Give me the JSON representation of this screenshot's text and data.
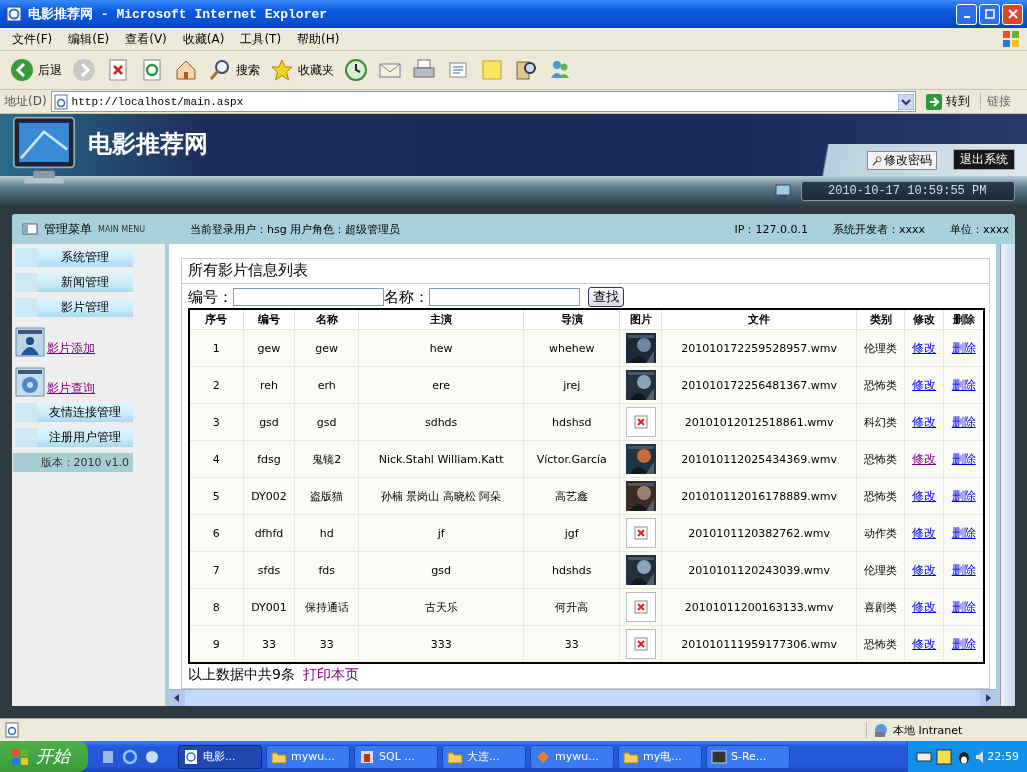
{
  "window": {
    "title": "电影推荐网 - Microsoft Internet Explorer"
  },
  "menu_bar": [
    "文件(F)",
    "编辑(E)",
    "查看(V)",
    "收藏(A)",
    "工具(T)",
    "帮助(H)"
  ],
  "toolbar": [
    {
      "kind": "back",
      "label": "后退"
    },
    {
      "kind": "forward"
    },
    {
      "kind": "stop"
    },
    {
      "kind": "refresh"
    },
    {
      "kind": "home"
    },
    {
      "kind": "search",
      "label": "搜索"
    },
    {
      "kind": "favorites",
      "label": "收藏夹"
    },
    {
      "kind": "history"
    },
    {
      "kind": "mail"
    },
    {
      "kind": "print"
    },
    {
      "kind": "edit"
    },
    {
      "kind": "notes"
    },
    {
      "kind": "research"
    },
    {
      "kind": "messenger"
    }
  ],
  "address_bar": {
    "label": "地址(D)",
    "value": "http://localhost/main.aspx",
    "go": "转到",
    "links": "链接"
  },
  "site": {
    "title": "电影推荐网",
    "change_password": "修改密码",
    "logout": "退出系统",
    "datetime": "2010-10-17 10:59:55 PM"
  },
  "info_bar": {
    "menu_title": "管理菜单",
    "menu_subtitle": "MAIN MENU",
    "user": "当前登录用户：hsg  用户角色：超级管理员",
    "ip": "IP：127.0.0.1",
    "developer": "系统开发者：xxxx",
    "unit": "单位：xxxx"
  },
  "sidebar": {
    "items": [
      {
        "kind": "section",
        "label": "系统管理"
      },
      {
        "kind": "section",
        "label": "新闻管理"
      },
      {
        "kind": "section",
        "label": "影片管理"
      },
      {
        "kind": "link",
        "label": "影片添加"
      },
      {
        "kind": "link",
        "label": "影片查询"
      },
      {
        "kind": "section",
        "label": "友情连接管理"
      },
      {
        "kind": "section",
        "label": "注册用户管理"
      }
    ],
    "version": "版本：2010 v1.0"
  },
  "panel": {
    "title": "所有影片信息列表",
    "search_fields": [
      {
        "label": "编号："
      },
      {
        "label": "名称："
      }
    ],
    "search_button": "查找",
    "footer": "以上数据中共9条",
    "print_link": "打印本页"
  },
  "table": {
    "columns": [
      "序号",
      "编号",
      "名称",
      "主演",
      "导演",
      "图片",
      "文件",
      "类别",
      "修改",
      "删除"
    ],
    "rows": [
      {
        "no": "1",
        "code": "gew",
        "name": "gew",
        "actors": "hew",
        "director": "whehew",
        "file": "201010172259528957.wmv",
        "genre": "伦理类",
        "edit": "修改",
        "edit_visited": false,
        "delete": "删除"
      },
      {
        "no": "2",
        "code": "reh",
        "name": "erh",
        "actors": "ere",
        "director": "jrej",
        "file": "201010172256481367.wmv",
        "genre": "恐怖类",
        "edit": "修改",
        "edit_visited": false,
        "delete": "删除"
      },
      {
        "no": "3",
        "code": "gsd",
        "name": "gsd",
        "actors": "sdhds",
        "director": "hdshsd",
        "poster": {
          "kind": "broken"
        },
        "file": "20101012012518861.wmv",
        "genre": "科幻类",
        "edit": "修改",
        "edit_visited": false,
        "delete": "删除"
      },
      {
        "no": "4",
        "code": "fdsg",
        "name": "鬼镜2",
        "actors": "Nick.Stahl William.Katt",
        "director": "Víctor.García",
        "file": "201010112025434369.wmv",
        "genre": "恐怖类",
        "edit": "修改",
        "edit_visited": true,
        "delete": "删除"
      },
      {
        "no": "5",
        "code": "DY002",
        "name": "盗版猫",
        "actors": "孙楠 景岗山 高晓松 阿朵",
        "director": "高艺鑫",
        "file": "201010112016178889.wmv",
        "genre": "恐怖类",
        "edit": "修改",
        "edit_visited": false,
        "delete": "删除"
      },
      {
        "no": "6",
        "code": "dfhfd",
        "name": "hd",
        "actors": "jf",
        "director": "jgf",
        "poster": {
          "kind": "broken"
        },
        "file": "2010101120382762.wmv",
        "genre": "动作类",
        "edit": "修改",
        "edit_visited": false,
        "delete": "删除"
      },
      {
        "no": "7",
        "code": "sfds",
        "name": "fds",
        "actors": "gsd",
        "director": "hdshds",
        "file": "2010101120243039.wmv",
        "genre": "伦理类",
        "edit": "修改",
        "edit_visited": false,
        "delete": "删除"
      },
      {
        "no": "8",
        "code": "DY001",
        "name": "保持通话",
        "actors": "古天乐",
        "director": "何升高",
        "poster": {
          "kind": "broken"
        },
        "file": "20101011200163133.wmv",
        "genre": "喜剧类",
        "edit": "修改",
        "edit_visited": false,
        "delete": "删除"
      },
      {
        "no": "9",
        "code": "33",
        "name": "33",
        "actors": "333",
        "director": "33",
        "poster": {
          "kind": "broken"
        },
        "file": "201010111959177306.wmv",
        "genre": "恐怖类",
        "edit": "修改",
        "edit_visited": false,
        "delete": "删除"
      }
    ]
  },
  "status_bar": {
    "zone": "本地 Intranet"
  },
  "taskbar": {
    "start": "开始",
    "items": [
      {
        "label": "电影...",
        "selected": true
      },
      {
        "label": "mywu...",
        "selected": false
      },
      {
        "label": "SQL ...",
        "selected": false
      },
      {
        "label": "大连...",
        "selected": false
      },
      {
        "label": "mywu...",
        "selected": false
      },
      {
        "label": "my电...",
        "selected": false
      },
      {
        "label": "S-Re...",
        "selected": false
      }
    ],
    "clock": "22:59"
  }
}
